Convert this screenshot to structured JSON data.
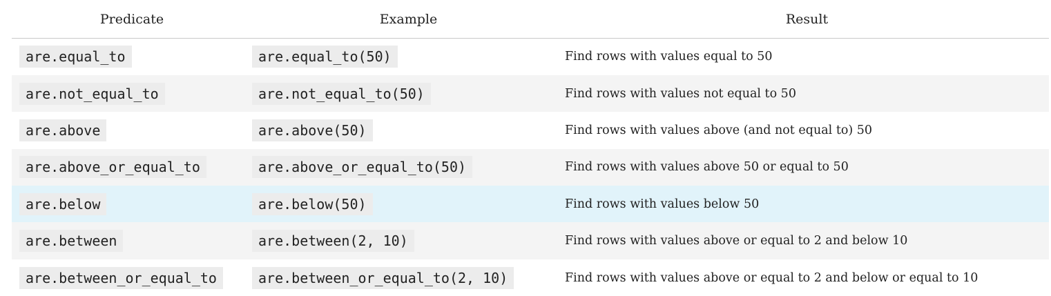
{
  "headers": {
    "predicate": "Predicate",
    "example": "Example",
    "result": "Result"
  },
  "rows": [
    {
      "predicate": "are.equal_to",
      "example": "are.equal_to(50)",
      "result": "Find rows with values equal to 50"
    },
    {
      "predicate": "are.not_equal_to",
      "example": "are.not_equal_to(50)",
      "result": "Find rows with values not equal to 50"
    },
    {
      "predicate": "are.above",
      "example": "are.above(50)",
      "result": "Find rows with values above (and not equal to) 50"
    },
    {
      "predicate": "are.above_or_equal_to",
      "example": "are.above_or_equal_to(50)",
      "result": "Find rows with values above 50 or equal to 50"
    },
    {
      "predicate": "are.below",
      "example": "are.below(50)",
      "result": "Find rows with values below 50"
    },
    {
      "predicate": "are.between",
      "example": "are.between(2, 10)",
      "result": "Find rows with values above or equal to 2 and below 10"
    },
    {
      "predicate": "are.between_or_equal_to",
      "example": "are.between_or_equal_to(2, 10)",
      "result": "Find rows with values above or equal to 2 and below or equal to 10"
    }
  ],
  "colors": {
    "highlight_row": "#e1f3fa",
    "striped_row": "#f4f4f4",
    "code_background": "#ececec"
  }
}
